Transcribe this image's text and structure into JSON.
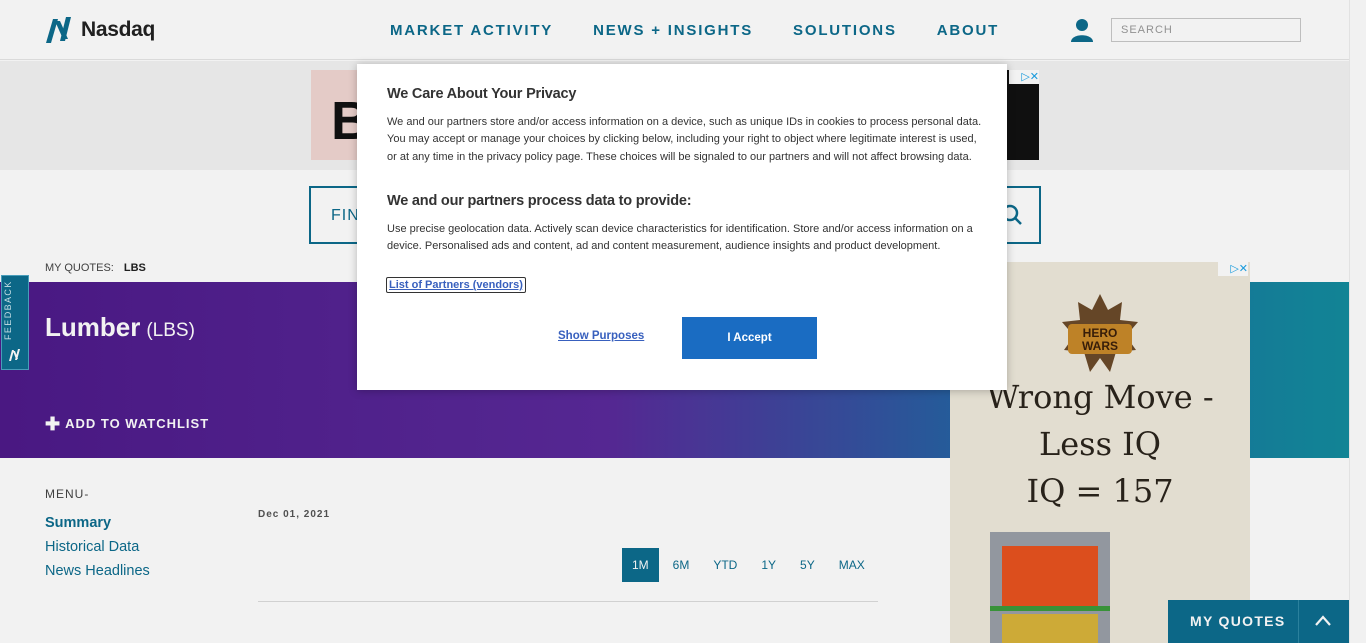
{
  "header": {
    "logo_text": "Nasdaq",
    "nav": [
      "MARKET ACTIVITY",
      "NEWS + INSIGHTS",
      "SOLUTIONS",
      "ABOUT"
    ],
    "search_placeholder": "SEARCH"
  },
  "top_ad": {
    "letter": "B"
  },
  "find_placeholder": "FIND",
  "my_quotes": {
    "label": "MY QUOTES:",
    "symbol": "LBS"
  },
  "quote": {
    "name": "Lumber",
    "symbol": "(LBS)",
    "watchlist": "ADD TO WATCHLIST"
  },
  "feedback": {
    "label": "FEEDBACK"
  },
  "menu": {
    "label": "MENU-",
    "items": [
      "Summary",
      "Historical Data",
      "News Headlines"
    ]
  },
  "chart": {
    "date": "Dec 01, 2021",
    "ranges": [
      "1M",
      "6M",
      "YTD",
      "1Y",
      "5Y",
      "MAX"
    ],
    "active_range": "1M"
  },
  "side_ad": {
    "brand": "HERO WARS",
    "lines": [
      "Wrong Move -",
      "Less IQ",
      "IQ = 157"
    ]
  },
  "my_quotes_bar": {
    "label": "MY QUOTES"
  },
  "consent": {
    "title": "We Care About Your Privacy",
    "body": "We and our partners store and/or access information on a device, such as unique IDs in cookies to process personal data. You may accept or manage your choices by clicking below, including your right to object where legitimate interest is used, or at any time in the privacy policy page. These choices will be signaled to our partners and will not affect browsing data.",
    "subtitle": "We and our partners process data to provide:",
    "purposes": "Use precise geolocation data. Actively scan device characteristics for identification. Store and/or access information on a device. Personalised ads and content, ad and content measurement, audience insights and product development.",
    "partners_link": "List of Partners (vendors)",
    "show_purposes": "Show Purposes",
    "accept": "I Accept"
  },
  "colors": {
    "brand": "#0d6d8f",
    "accept": "#1a6cc2",
    "link": "#3860be"
  }
}
